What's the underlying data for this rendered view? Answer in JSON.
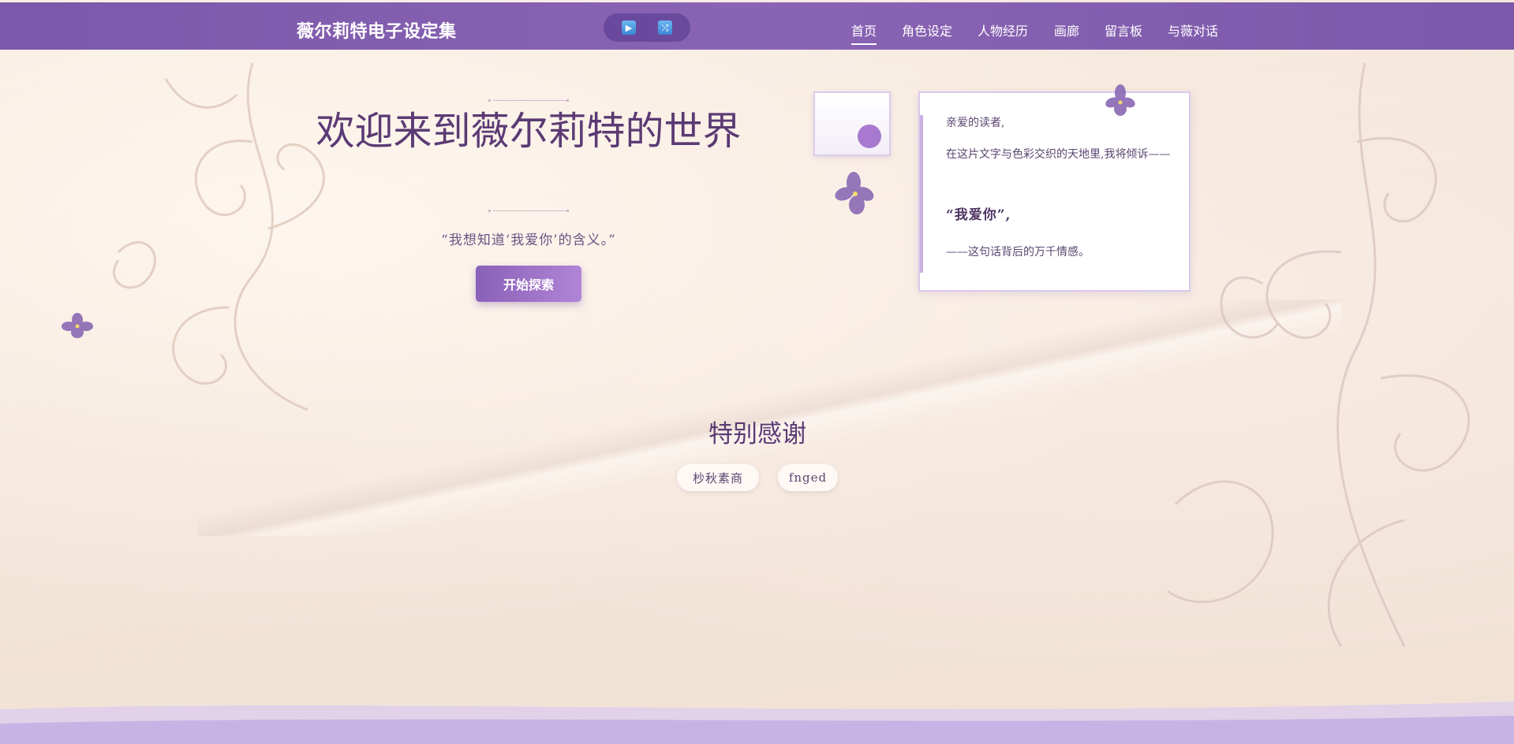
{
  "header": {
    "brand": "薇尔莉特电子设定集",
    "player": {
      "play_icon": "▶",
      "shuffle_icon": "⤮"
    },
    "nav": [
      {
        "label": "首页",
        "active": true
      },
      {
        "label": "角色设定",
        "active": false
      },
      {
        "label": "人物经历",
        "active": false
      },
      {
        "label": "画廊",
        "active": false
      },
      {
        "label": "留言板",
        "active": false
      },
      {
        "label": "与薇对话",
        "active": false
      }
    ]
  },
  "hero": {
    "title": "欢迎来到薇尔莉特的世界",
    "quote": "“我想知道‘我爱你’的含义。”",
    "button": "开始探索"
  },
  "letter": {
    "greeting": "亲爱的读者,",
    "line1": "在这片文字与色彩交织的天地里,我将倾诉——",
    "emphasis": "“我爱你”,",
    "line2": "——这句话背后的万千情感。"
  },
  "thanks": {
    "title": "特别感谢",
    "names": [
      "杪秋素商",
      "fnged"
    ]
  },
  "colors": {
    "header_bg": "#7b58aa",
    "accent": "#a77ad0",
    "title_text": "#5b3a74",
    "paper_bg": "#f5e8dc",
    "wave": "#c8b4e4"
  }
}
